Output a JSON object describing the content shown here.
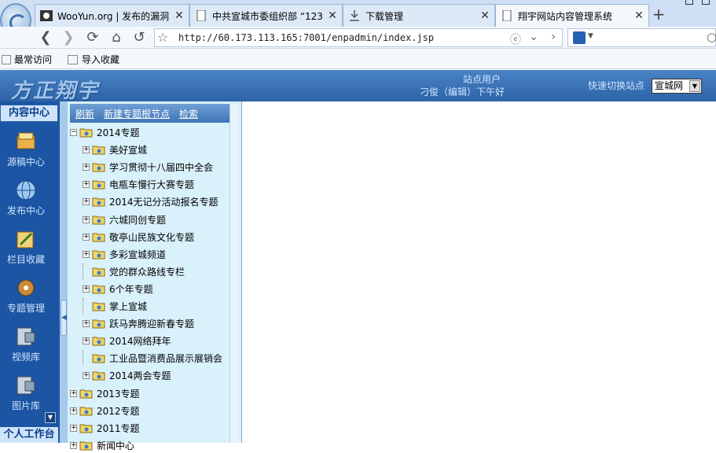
{
  "browser": {
    "tabs": [
      {
        "label": "WooYun.org | 发布的漏洞",
        "icon": "wooyun-icon",
        "active": false
      },
      {
        "label": "中共宣城市委组织部 “123",
        "icon": "page-icon",
        "active": false
      },
      {
        "label": "下载管理",
        "icon": "download-icon",
        "active": false
      },
      {
        "label": "翔宇网站内容管理系统",
        "icon": "page-icon",
        "active": true
      }
    ],
    "url": "http://60.173.113.165:7001/enpadmin/index.jsp",
    "bookmarks": [
      "最常访问",
      "导入收藏"
    ]
  },
  "header": {
    "brand": "方正翔宇",
    "site_user_label": "站点用户",
    "user_info": "刁俊（编辑）下午好",
    "quick_switch_label": "快速切换站点",
    "site_selected": "宣城网"
  },
  "leftnav": {
    "title": "内容中心",
    "items": [
      {
        "label": "源稿中心",
        "icon": "source-draft-icon"
      },
      {
        "label": "发布中心",
        "icon": "globe-icon"
      },
      {
        "label": "栏目收藏",
        "icon": "favorites-icon"
      },
      {
        "label": "专题管理",
        "icon": "disc-icon"
      },
      {
        "label": "视频库",
        "icon": "video-library-icon"
      },
      {
        "label": "图片库",
        "icon": "image-library-icon"
      }
    ],
    "personal": "个人工作台"
  },
  "tree": {
    "toolbar": {
      "refresh": "刷新",
      "new_root": "新建专题根节点",
      "search": "检索"
    },
    "root": "2014专题",
    "children": [
      {
        "label": "美好宣城",
        "expandable": true
      },
      {
        "label": "学习贯彻十八届四中全会",
        "expandable": true
      },
      {
        "label": "电瓶车慢行大赛专题",
        "expandable": true
      },
      {
        "label": "2014无记分活动报名专题",
        "expandable": true
      },
      {
        "label": "六城同创专题",
        "expandable": true
      },
      {
        "label": "敬亭山民族文化专题",
        "expandable": true
      },
      {
        "label": "多彩宣城频道",
        "expandable": true
      },
      {
        "label": "党的群众路线专栏",
        "expandable": false
      },
      {
        "label": "6个年专题",
        "expandable": true
      },
      {
        "label": "掌上宣城",
        "expandable": false
      },
      {
        "label": "跃马奔腾迎新春专题",
        "expandable": true
      },
      {
        "label": "2014网络拜年",
        "expandable": true
      },
      {
        "label": "工业品暨消费品展示展销会",
        "expandable": false
      },
      {
        "label": "2014两会专题",
        "expandable": true
      }
    ],
    "siblings": [
      "2013专题",
      "2012专题",
      "2011专题",
      "新闻中心"
    ]
  }
}
